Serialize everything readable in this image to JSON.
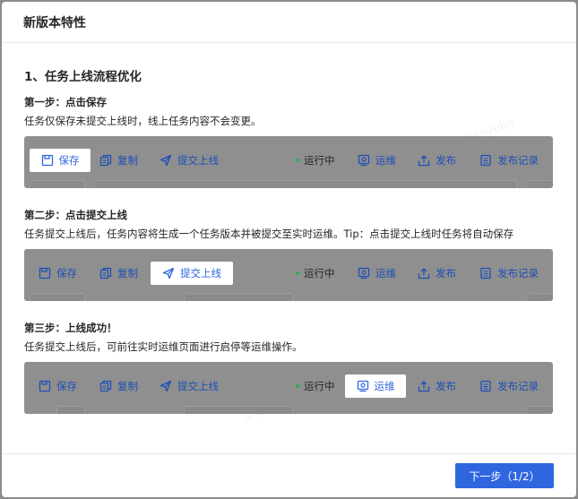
{
  "modal": {
    "title": "新版本特性",
    "section_title": "1、任务上线流程优化",
    "next_button": "下一步（1/2）"
  },
  "watermark": "shenyulin",
  "toolbar": {
    "save": "保存",
    "copy": "复制",
    "submit": "提交上线",
    "status": "运行中",
    "ops": "运维",
    "publish": "发布",
    "publish_log": "发布记录"
  },
  "steps": [
    {
      "title": "第一步：点击保存",
      "desc": "任务仅保存未提交上线时，线上任务内容不会变更。",
      "highlight": "save"
    },
    {
      "title": "第二步：点击提交上线",
      "desc": "任务提交上线后，任务内容将生成一个任务版本并被提交至实时运维。Tip：点击提交上线时任务将自动保存",
      "highlight": "submit"
    },
    {
      "title": "第三步：上线成功！",
      "desc": "任务提交上线后，可前往实时运维页面进行启停等运维操作。",
      "highlight": "ops"
    }
  ],
  "colors": {
    "primary": "#2f66e0",
    "toolbar_text": "#1d4fb8",
    "status_dot": "#2eae58",
    "overlay": "#8f8f8f"
  }
}
